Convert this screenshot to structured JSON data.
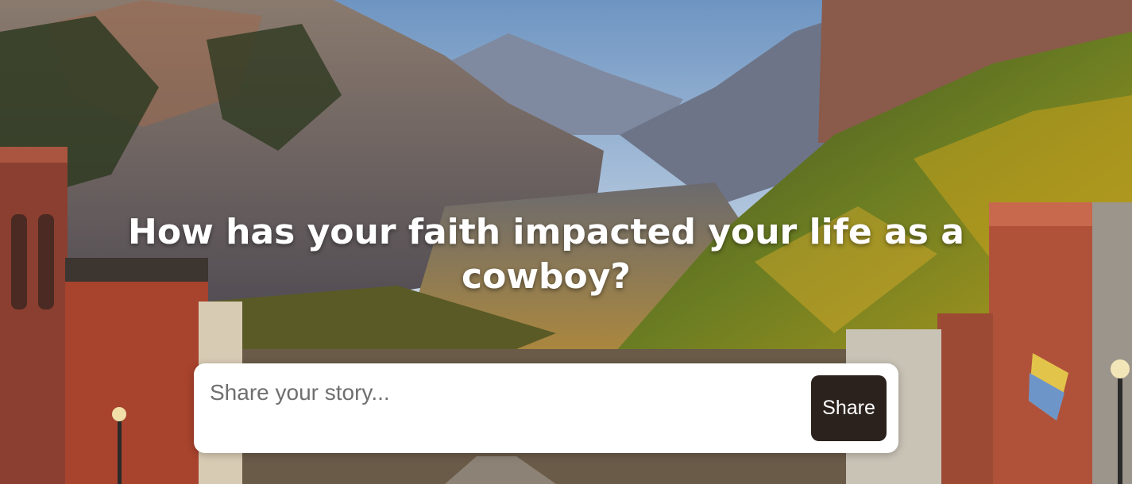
{
  "hero": {
    "image": "mountain-town-landscape",
    "heading": "How has your faith impacted your life as a cowboy?"
  },
  "story_form": {
    "placeholder": "Share your story...",
    "value": "",
    "submit_label": "Share"
  },
  "colors": {
    "button_bg": "#2b221d",
    "button_text": "#ffffff",
    "heading_text": "#ffffff",
    "input_bg": "#ffffff"
  }
}
